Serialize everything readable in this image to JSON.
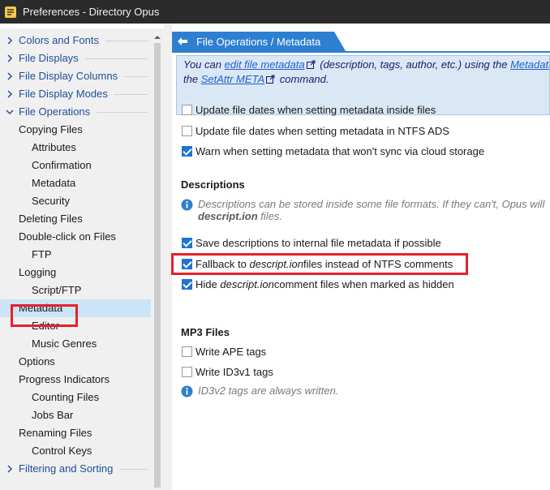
{
  "window": {
    "title": "Preferences - Directory Opus"
  },
  "sidebar": {
    "items": [
      {
        "label": "Colors and Fonts",
        "type": "category"
      },
      {
        "label": "File Displays",
        "type": "category"
      },
      {
        "label": "File Display Columns",
        "type": "category"
      },
      {
        "label": "File Display Modes",
        "type": "category"
      },
      {
        "label": "File Operations",
        "type": "category-expanded"
      },
      {
        "label": "Copying Files",
        "type": "child"
      },
      {
        "label": "Attributes",
        "type": "grandchild"
      },
      {
        "label": "Confirmation",
        "type": "grandchild"
      },
      {
        "label": "Metadata",
        "type": "grandchild"
      },
      {
        "label": "Security",
        "type": "grandchild"
      },
      {
        "label": "Deleting Files",
        "type": "child"
      },
      {
        "label": "Double-click on Files",
        "type": "child"
      },
      {
        "label": "FTP",
        "type": "grandchild"
      },
      {
        "label": "Logging",
        "type": "child"
      },
      {
        "label": "Script/FTP",
        "type": "grandchild"
      },
      {
        "label": "Metadata",
        "type": "child-selected"
      },
      {
        "label": "Editor",
        "type": "grandchild"
      },
      {
        "label": "Music Genres",
        "type": "grandchild"
      },
      {
        "label": "Options",
        "type": "child"
      },
      {
        "label": "Progress Indicators",
        "type": "child"
      },
      {
        "label": "Counting Files",
        "type": "grandchild"
      },
      {
        "label": "Jobs Bar",
        "type": "grandchild"
      },
      {
        "label": "Renaming Files",
        "type": "child"
      },
      {
        "label": "Control Keys",
        "type": "grandchild"
      },
      {
        "label": "Filtering and Sorting",
        "type": "category"
      }
    ]
  },
  "header": {
    "title": "File Operations / Metadata"
  },
  "banner": {
    "l1_a": "You can ",
    "l1_link": "edit file metadata",
    "l1_b": " (description, tags, author, etc.) using the ",
    "l1_link2": "Metadata",
    "l2_a": "the ",
    "l2_link": "SetAttr META",
    "l2_b": " command."
  },
  "options_top": [
    {
      "label": "Update file dates when setting metadata inside files",
      "checked": false
    },
    {
      "label": "Update file dates when setting metadata in NTFS ADS",
      "checked": false
    },
    {
      "label": "Warn when setting metadata that won't sync via cloud storage",
      "checked": true
    }
  ],
  "descriptions": {
    "heading": "Descriptions",
    "note_l1": "Descriptions can be stored inside some file formats. If they can't, Opus will",
    "note_l2_bold": "descript.ion",
    "note_l2_rest": " files.",
    "opt1": "Save descriptions to internal file metadata if possible",
    "opt2_a": "Fallback to ",
    "opt2_em": "descript.ion",
    "opt2_b": " files instead of NTFS comments",
    "opt3_a": "Hide ",
    "opt3_em": "descript.ion",
    "opt3_b": " comment files when marked as hidden"
  },
  "mp3": {
    "heading": "MP3 Files",
    "opt1": "Write APE tags",
    "opt2": "Write ID3v1 tags",
    "note": "ID3v2 tags are always written."
  },
  "colors": {
    "accent": "#2e7fd1",
    "highlight": "#e8202a",
    "selected": "#cce4f7"
  }
}
